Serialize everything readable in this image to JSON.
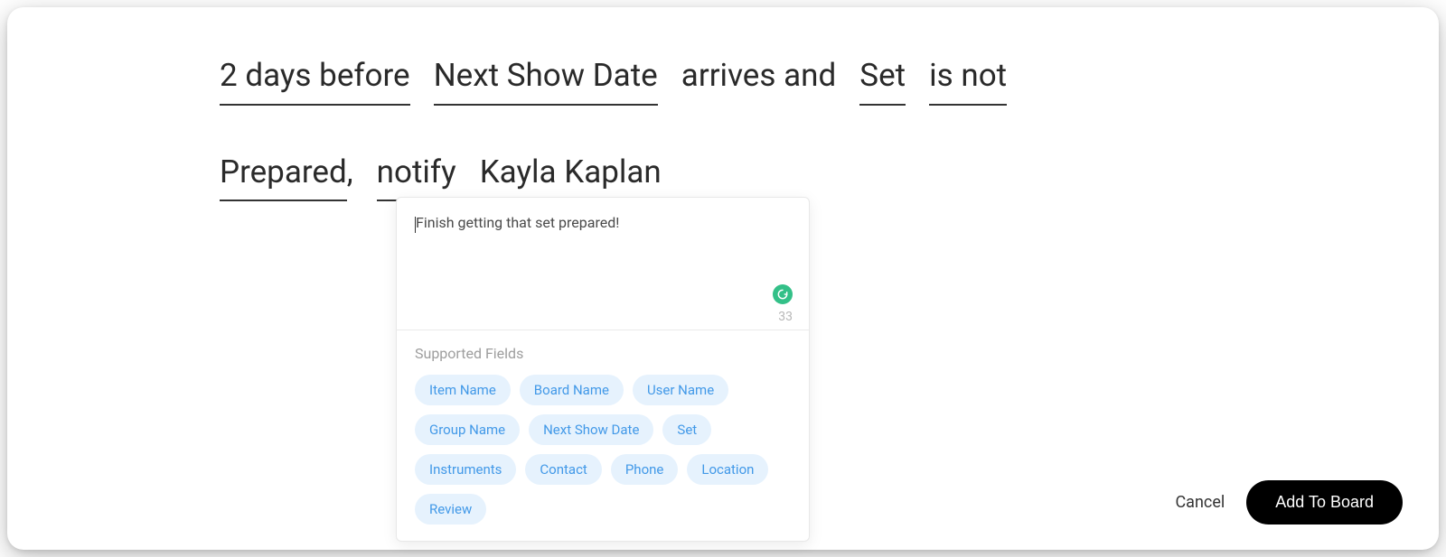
{
  "rule": {
    "time_offset": "2 days before",
    "date_field": "Next Show Date",
    "connector1": "arrives and",
    "status_field": "Set",
    "status_condition": "is not",
    "status_value": "Prepared",
    "comma": ",",
    "action": "notify",
    "recipient": "Kayla Kaplan"
  },
  "popover": {
    "message_text": "Finish getting that set prepared!",
    "char_count": "33",
    "supported_label": "Supported Fields",
    "chips": [
      "Item Name",
      "Board Name",
      "User Name",
      "Group Name",
      "Next Show Date",
      "Set",
      "Instruments",
      "Contact",
      "Phone",
      "Location",
      "Review"
    ]
  },
  "actions": {
    "cancel": "Cancel",
    "add": "Add To Board"
  }
}
